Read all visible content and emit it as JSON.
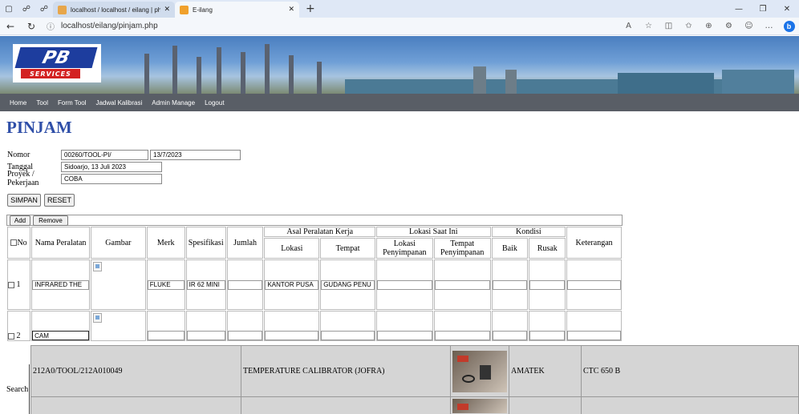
{
  "browser": {
    "tabs": [
      {
        "title": "localhost / localhost / eilang | php",
        "active": false
      },
      {
        "title": "E-ilang",
        "active": true
      }
    ],
    "url": "localhost/eilang/pinjam.php"
  },
  "logo": {
    "mark": "PB",
    "sub": "SERVICES"
  },
  "menu": [
    "Home",
    "Tool",
    "Form Tool",
    "Jadwal Kalibrasi",
    "Admin Manage",
    "Logout"
  ],
  "page_title": "PINJAM",
  "form": {
    "nomor_label": "Nomor",
    "nomor_value": "00260/TOOL-PI/",
    "nomor_date": "13/7/2023",
    "tanggal_label": "Tanggal",
    "tanggal_value": "Sidoarjo, 13 Juli 2023",
    "proyek_label": "Proyek / Pekerjaan",
    "proyek_value": "COBA"
  },
  "buttons": {
    "simpan": "SIMPAN",
    "reset": "RESET",
    "add": "Add",
    "remove": "Remove"
  },
  "table": {
    "headers": {
      "no": "No",
      "nama": "Nama Peralatan",
      "gambar": "Gambar",
      "merk": "Merk",
      "spesifikasi": "Spesifikasi",
      "jumlah": "Jumlah",
      "asal": "Asal Peralatan Kerja",
      "asal_lokasi": "Lokasi",
      "asal_tempat": "Tempat",
      "lokasi_saat_ini": "Lokasi Saat Ini",
      "lokasi_penyimpanan": "Lokasi Penyimpanan",
      "tempat_penyimpanan": "Tempat Penyimpanan",
      "kondisi": "Kondisi",
      "baik": "Baik",
      "rusak": "Rusak",
      "keterangan": "Keterangan"
    },
    "rows": [
      {
        "no": "1",
        "nama": "INFRARED THE",
        "merk": "FLUKE",
        "spesifikasi": "IR 62 MINI",
        "jumlah": "",
        "asal_lokasi": "KANTOR PUSA",
        "asal_tempat": "GUDANG PENU"
      },
      {
        "no": "2",
        "nama": "CAM",
        "merk": "",
        "spesifikasi": "",
        "jumlah": "",
        "asal_lokasi": "",
        "asal_tempat": ""
      }
    ]
  },
  "search": {
    "label": "Search",
    "results": [
      {
        "code": "212A0/TOOL/212A010049",
        "name": "TEMPERATURE CALIBRATOR (JOFRA)",
        "merk": "AMATEK",
        "model": "CTC 650 B"
      }
    ]
  }
}
